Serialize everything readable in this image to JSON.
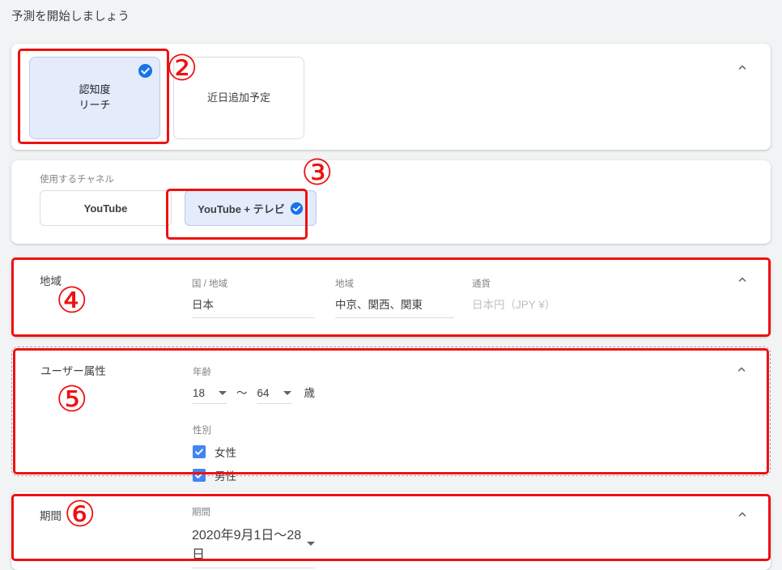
{
  "page": {
    "title": "予測を開始しましょう"
  },
  "objective_section": {
    "chevron_icon": "chevron-up-icon",
    "cards": [
      {
        "title": "認知度",
        "subtitle": "リーチ",
        "selected": true,
        "check_icon": "check-circle-icon"
      },
      {
        "title": "近日追加予定",
        "subtitle": "",
        "selected": false
      }
    ]
  },
  "channel_section": {
    "label": "使用するチャネル",
    "buttons": [
      {
        "label": "YouTube",
        "selected": false
      },
      {
        "label": "YouTube + テレビ",
        "selected": true,
        "check_icon": "check-circle-icon"
      }
    ]
  },
  "region_section": {
    "title": "地域",
    "chevron_icon": "chevron-up-icon",
    "fields": [
      {
        "label": "国 / 地域",
        "value": "日本",
        "disabled": false
      },
      {
        "label": "地域",
        "value": "中京、関西、関東",
        "disabled": false
      },
      {
        "label": "通貨",
        "value": "日本円（JPY ¥）",
        "disabled": true
      }
    ]
  },
  "demographics_section": {
    "title": "ユーザー属性",
    "chevron_icon": "chevron-up-icon",
    "age": {
      "label": "年齢",
      "from": "18",
      "separator": "〜",
      "to": "64",
      "unit": "歳",
      "caret_icon": "caret-down-icon"
    },
    "gender": {
      "label": "性別",
      "options": [
        {
          "label": "女性",
          "checked": true
        },
        {
          "label": "男性",
          "checked": true
        }
      ]
    }
  },
  "period_section": {
    "title": "期間",
    "chevron_icon": "chevron-up-icon",
    "field": {
      "label": "期間",
      "value": "2020年9月1日〜28日",
      "caret_icon": "caret-down-icon"
    }
  },
  "annotations": {
    "markers": [
      "②",
      "③",
      "④",
      "⑤",
      "⑥"
    ]
  },
  "colors": {
    "accent_blue": "#1a73e8",
    "selected_fill": "#e4ebfb",
    "annotation_red": "#ee1111",
    "background": "#f1f3f4"
  }
}
